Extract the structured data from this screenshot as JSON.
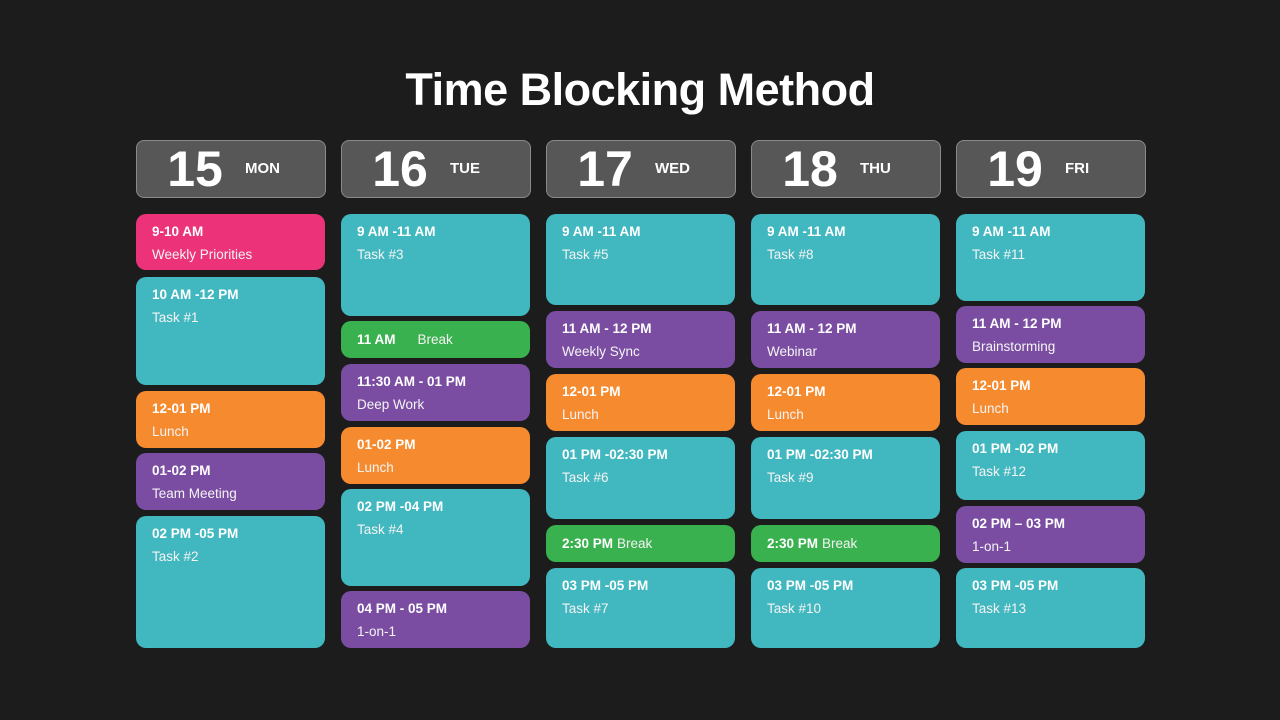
{
  "title": "Time Blocking Method",
  "colors": {
    "background": "#1c1c1c",
    "header_bg": "#575757",
    "task": "#41b7bf",
    "meeting": "#7a4da2",
    "lunch": "#f68a2f",
    "break": "#39b14f",
    "priority": "#ec3278"
  },
  "days": [
    {
      "number": "15",
      "name": "MON",
      "blocks": [
        {
          "time": "9-10 AM",
          "label": "Weekly Priorities",
          "kind": "priority"
        },
        {
          "time": "10 AM -12 PM",
          "label": "Task #1",
          "kind": "task"
        },
        {
          "time": "12-01 PM",
          "label": "Lunch",
          "kind": "lunch"
        },
        {
          "time": "01-02 PM",
          "label": "Team Meeting",
          "kind": "meeting"
        },
        {
          "time": "02 PM -05 PM",
          "label": "Task #2",
          "kind": "task"
        }
      ]
    },
    {
      "number": "16",
      "name": "TUE",
      "blocks": [
        {
          "time": "9 AM -11 AM",
          "label": "Task #3",
          "kind": "task"
        },
        {
          "time": "11 AM",
          "label": "Break",
          "kind": "break"
        },
        {
          "time": "11:30 AM - 01 PM",
          "label": "Deep Work",
          "kind": "meeting"
        },
        {
          "time": "01-02 PM",
          "label": "Lunch",
          "kind": "lunch"
        },
        {
          "time": "02 PM -04 PM",
          "label": "Task #4",
          "kind": "task"
        },
        {
          "time": "04 PM - 05 PM",
          "label": "1-on-1",
          "kind": "meeting"
        }
      ]
    },
    {
      "number": "17",
      "name": "WED",
      "blocks": [
        {
          "time": "9 AM -11 AM",
          "label": "Task #5",
          "kind": "task"
        },
        {
          "time": "11 AM - 12 PM",
          "label": "Weekly Sync",
          "kind": "meeting"
        },
        {
          "time": "12-01 PM",
          "label": "Lunch",
          "kind": "lunch"
        },
        {
          "time": "01 PM -02:30 PM",
          "label": "Task #6",
          "kind": "task"
        },
        {
          "time": "2:30 PM",
          "label": "Break",
          "kind": "break"
        },
        {
          "time": "03 PM -05 PM",
          "label": "Task #7",
          "kind": "task"
        }
      ]
    },
    {
      "number": "18",
      "name": "THU",
      "blocks": [
        {
          "time": "9 AM -11 AM",
          "label": "Task #8",
          "kind": "task"
        },
        {
          "time": "11 AM - 12 PM",
          "label": "Webinar",
          "kind": "meeting"
        },
        {
          "time": "12-01 PM",
          "label": "Lunch",
          "kind": "lunch"
        },
        {
          "time": "01 PM -02:30 PM",
          "label": "Task #9",
          "kind": "task"
        },
        {
          "time": "2:30 PM",
          "label": "Break",
          "kind": "break"
        },
        {
          "time": "03 PM -05 PM",
          "label": "Task #10",
          "kind": "task"
        }
      ]
    },
    {
      "number": "19",
      "name": "FRI",
      "blocks": [
        {
          "time": "9 AM -11 AM",
          "label": "Task #11",
          "kind": "task"
        },
        {
          "time": "11 AM - 12 PM",
          "label": "Brainstorming",
          "kind": "meeting"
        },
        {
          "time": "12-01 PM",
          "label": "Lunch",
          "kind": "lunch"
        },
        {
          "time": "01 PM -02 PM",
          "label": "Task #12",
          "kind": "task"
        },
        {
          "time": "02 PM – 03 PM",
          "label": "1-on-1",
          "kind": "meeting"
        },
        {
          "time": "03 PM -05 PM",
          "label": "Task #13",
          "kind": "task"
        }
      ]
    }
  ]
}
